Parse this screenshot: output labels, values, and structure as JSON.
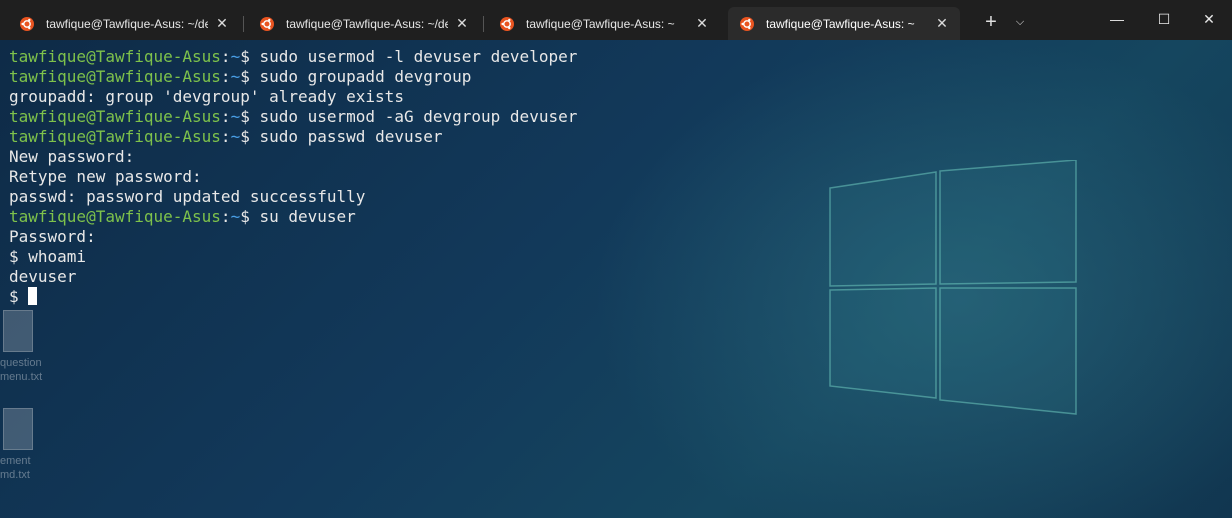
{
  "tabs": [
    {
      "title": "tawfique@Tawfique-Asus: ~/de",
      "close": "✕",
      "active": false
    },
    {
      "title": "tawfique@Tawfique-Asus: ~/de",
      "close": "✕",
      "active": false
    },
    {
      "title": "tawfique@Tawfique-Asus: ~",
      "close": "✕",
      "active": false
    },
    {
      "title": "tawfique@Tawfique-Asus: ~",
      "close": "✕",
      "active": true
    }
  ],
  "tabbar": {
    "new_tab": "+",
    "dropdown": "⌵"
  },
  "window_controls": {
    "minimize": "—",
    "maximize": "☐",
    "close": "✕"
  },
  "prompt": {
    "user_host": "tawfique@Tawfique-Asus",
    "colon": ":",
    "path": "~",
    "symbol": "$ "
  },
  "terminal": {
    "lines": [
      {
        "type": "prompt",
        "command": "sudo usermod -l devuser developer"
      },
      {
        "type": "prompt",
        "command": "sudo groupadd devgroup"
      },
      {
        "type": "output",
        "text": "groupadd: group 'devgroup' already exists"
      },
      {
        "type": "prompt",
        "command": "sudo usermod -aG devgroup devuser"
      },
      {
        "type": "prompt",
        "command": "sudo passwd devuser"
      },
      {
        "type": "output",
        "text": "New password:"
      },
      {
        "type": "output",
        "text": "Retype new password:"
      },
      {
        "type": "output",
        "text": "passwd: password updated successfully"
      },
      {
        "type": "prompt",
        "command": "su devuser"
      },
      {
        "type": "output",
        "text": "Password:"
      },
      {
        "type": "output",
        "text": "$ whoami"
      },
      {
        "type": "output",
        "text": "devuser"
      },
      {
        "type": "output",
        "text": "$ "
      }
    ]
  },
  "desktop_icons": [
    {
      "label": "question\nmenu.txt"
    },
    {
      "label": "ement\nmd.txt"
    }
  ],
  "colors": {
    "prompt_user": "#7ec24b",
    "prompt_path": "#4aa0e8",
    "text": "#e8e8e8",
    "tabbar": "#1f1f1f",
    "ubuntu": "#e95420"
  }
}
